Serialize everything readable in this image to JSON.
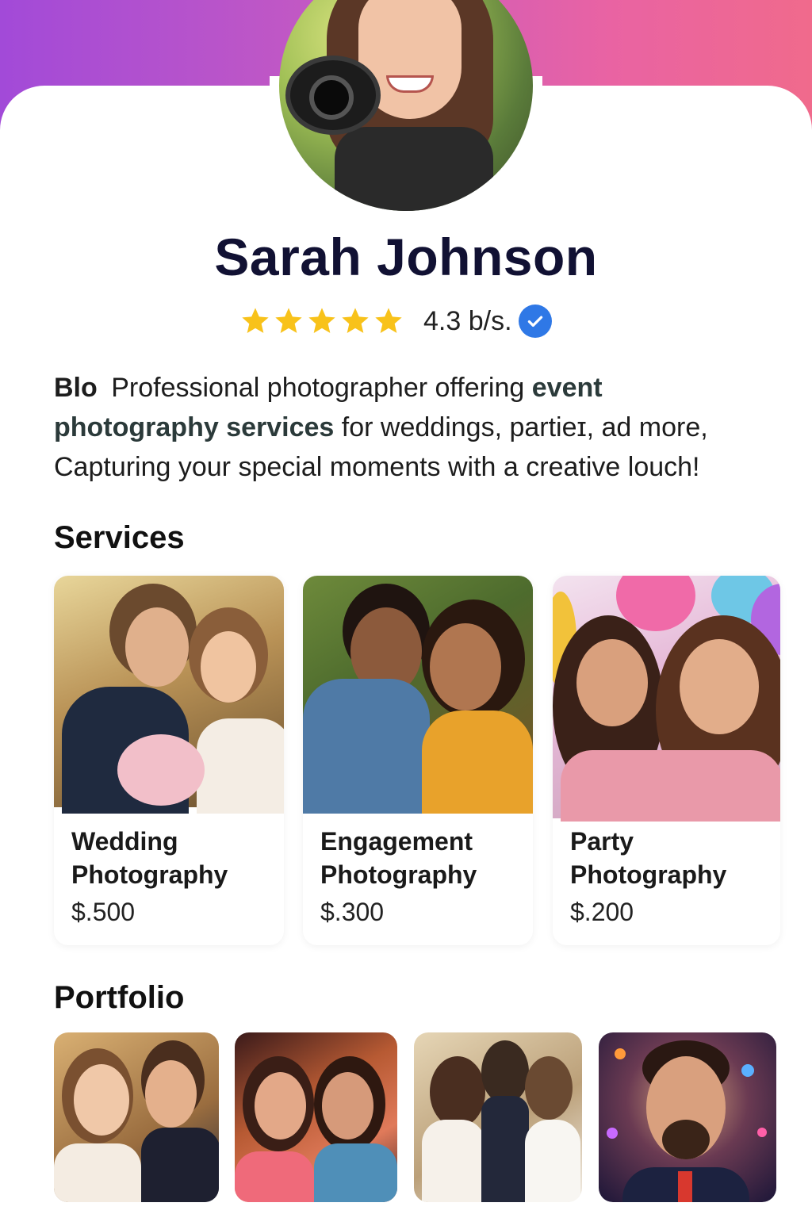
{
  "profile": {
    "name": "Sarah Johnson",
    "rating_text": "4.3 b/s.",
    "stars": 5,
    "verified": true
  },
  "bio": {
    "label": "Blo",
    "text_1": "Professional photographer offering ",
    "highlight": "event photography services",
    "text_2": " for weddings, partieɪ, ad more, Capturing your special moments with a creative louch!"
  },
  "services": {
    "title": "Services",
    "items": [
      {
        "title": "Wedding Photography",
        "price": "$.500"
      },
      {
        "title": "Engagement Photography",
        "price": "$.300"
      },
      {
        "title": "Party Photography",
        "price": "$.200"
      }
    ]
  },
  "portfolio": {
    "title": "Portfolio"
  },
  "colors": {
    "header_gradient_start": "#a24ad8",
    "header_gradient_end": "#f06a8c",
    "star": "#f8c21a",
    "verified": "#2f78e6",
    "name": "#111133"
  },
  "icons": {
    "rating": "star-icon",
    "verified": "verified-check-icon"
  }
}
